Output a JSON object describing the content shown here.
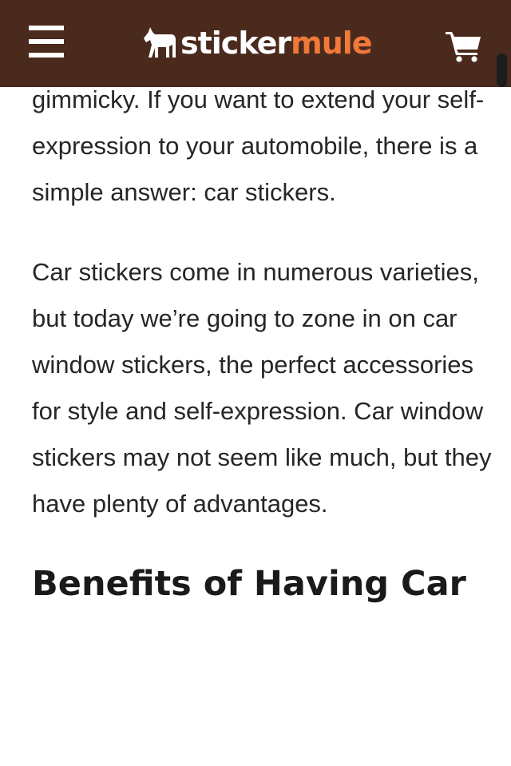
{
  "header": {
    "logo_part1": "sticker",
    "logo_part2": "mule",
    "menu_icon": "hamburger-menu-icon",
    "cart_icon": "shopping-cart-icon",
    "background_color": "#4a2a1d",
    "accent_color": "#f0793a"
  },
  "article": {
    "paragraphs": [
      "gimmicky. If you want to extend your self-expression to your automobile, there is a simple answer: car stickers.",
      "Car stickers come in numerous varieties, but today we’re going to zone in on car window stickers, the perfect accessories for style and self-expression. Car window stickers may not seem like much, but they have plenty of advantages."
    ],
    "heading": "Benefits of Having Car"
  }
}
